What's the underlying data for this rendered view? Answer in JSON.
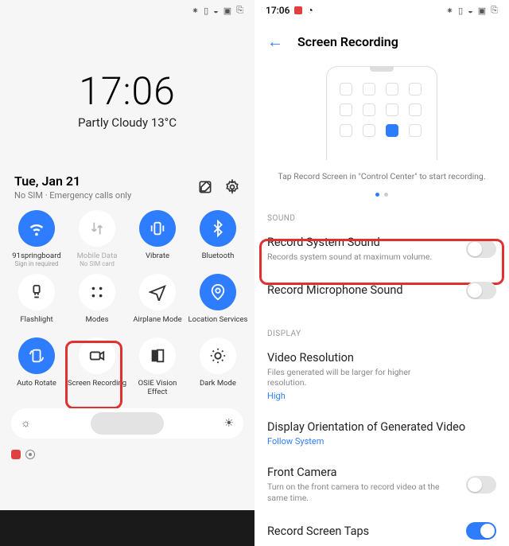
{
  "left": {
    "clock": "17:06",
    "weather": "Partly Cloudy 13°C",
    "date": "Tue, Jan 21",
    "sim": "No SIM · Emergency calls only",
    "tiles": [
      {
        "label": "91springboard",
        "sub": "Sign in required",
        "active": true,
        "icon": "wifi"
      },
      {
        "label": "Mobile Data",
        "sub": "No SIM card",
        "dim": true,
        "icon": "data"
      },
      {
        "label": "Vibrate",
        "sub": "",
        "active": true,
        "icon": "vibrate"
      },
      {
        "label": "Bluetooth",
        "sub": "",
        "active": true,
        "icon": "bt"
      },
      {
        "label": "Flashlight",
        "sub": "",
        "icon": "flash"
      },
      {
        "label": "Modes",
        "sub": "",
        "icon": "modes"
      },
      {
        "label": "Airplane Mode",
        "sub": "",
        "icon": "plane"
      },
      {
        "label": "Location Services",
        "sub": "",
        "active": true,
        "icon": "loc"
      },
      {
        "label": "Auto Rotate",
        "sub": "",
        "active": true,
        "icon": "rotate"
      },
      {
        "label": "Screen Recording",
        "sub": "",
        "icon": "rec"
      },
      {
        "label": "OSIE Vision Effect",
        "sub": "",
        "icon": "osie"
      },
      {
        "label": "Dark Mode",
        "sub": "",
        "icon": "dark"
      }
    ]
  },
  "right": {
    "status_time": "17:06",
    "title": "Screen Recording",
    "caption": "Tap Record Screen in \"Control Center\" to start recording.",
    "section_sound": "SOUND",
    "row_sys_sound": {
      "title": "Record System Sound",
      "sub": "Records system sound at maximum volume."
    },
    "row_mic": {
      "title": "Record Microphone Sound"
    },
    "section_display": "DISPLAY",
    "row_res": {
      "title": "Video Resolution",
      "sub": "Files generated will be larger for higher resolution.",
      "value": "High"
    },
    "row_orient": {
      "title": "Display Orientation of Generated Video",
      "value": "Follow System"
    },
    "row_cam": {
      "title": "Front Camera",
      "sub": "Turn on the front camera to record video at the same time."
    }
  }
}
